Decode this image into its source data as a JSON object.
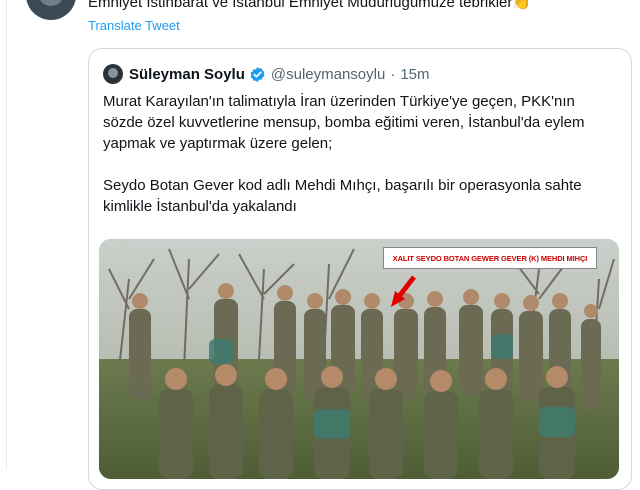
{
  "tweet": {
    "text_partial": "Emniyet İstihbarat ve İstanbul Emniyet Müdürlüğümüze tebrikler👏",
    "translate_label": "Translate Tweet"
  },
  "quoted_tweet": {
    "author_name": "Süleyman Soylu",
    "handle": "@suleymansoylu",
    "separator": "·",
    "time": "15m",
    "text": "Murat Karayılan'ın talimatıyla İran üzerinden Türkiye'ye geçen, PKK'nın sözde özel kuvvetlerine mensup, bomba eğitimi veren, İstanbul'da eylem yapmak ve yaptırmak üzere gelen;\n\nSeydo Botan Gever kod adlı Mehdi Mıhçı, başarılı bir operasyonla sahte kimlikle İstanbul'da yakalandı",
    "photo_caption": "XALIT SEYDO  BOTAN GEWER GEVER (K) MEHDI MIHÇI"
  },
  "icons": {
    "verified": "verified-badge-icon",
    "arrow": "red-arrow-icon"
  },
  "colors": {
    "link": "#1d9bf0",
    "verified": "#1d9bf0",
    "arrow": "#e00000"
  }
}
